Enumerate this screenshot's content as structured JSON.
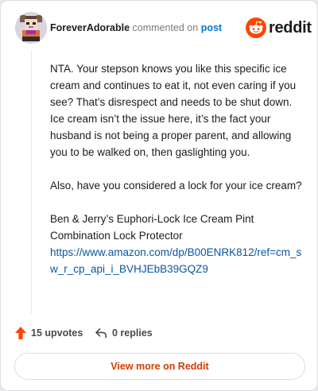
{
  "comment": {
    "username": "ForeverAdorable",
    "action": "commented on",
    "post_link": "post",
    "paragraphs": [
      "NTA. Your stepson knows you like this specific ice cream and continues to eat it, not even caring if you see? That’s disrespect and needs to be shut down. Ice cream isn’t the issue here, it’s the fact your husband is not being a proper parent, and allowing you to be walked on, then gaslighting you.",
      "Also, have you considered a lock for your ice cream?",
      "Ben & Jerry’s Euphori-Lock Ice Cream Pint Combination Lock Protector"
    ],
    "link_text": "https://www.amazon.com/dp/B00ENRK812/ref=cm_sw_r_cp_api_i_BVHJEbB39GQZ9"
  },
  "brand": {
    "name": "reddit",
    "color": "#ff4500"
  },
  "footer": {
    "upvotes": "15 upvotes",
    "replies": "0 replies"
  },
  "view_more_label": "View more on Reddit",
  "icons": {
    "upvote": "upvote-arrow-icon",
    "reply": "reply-arrow-icon",
    "logo": "reddit-snoo-icon"
  }
}
